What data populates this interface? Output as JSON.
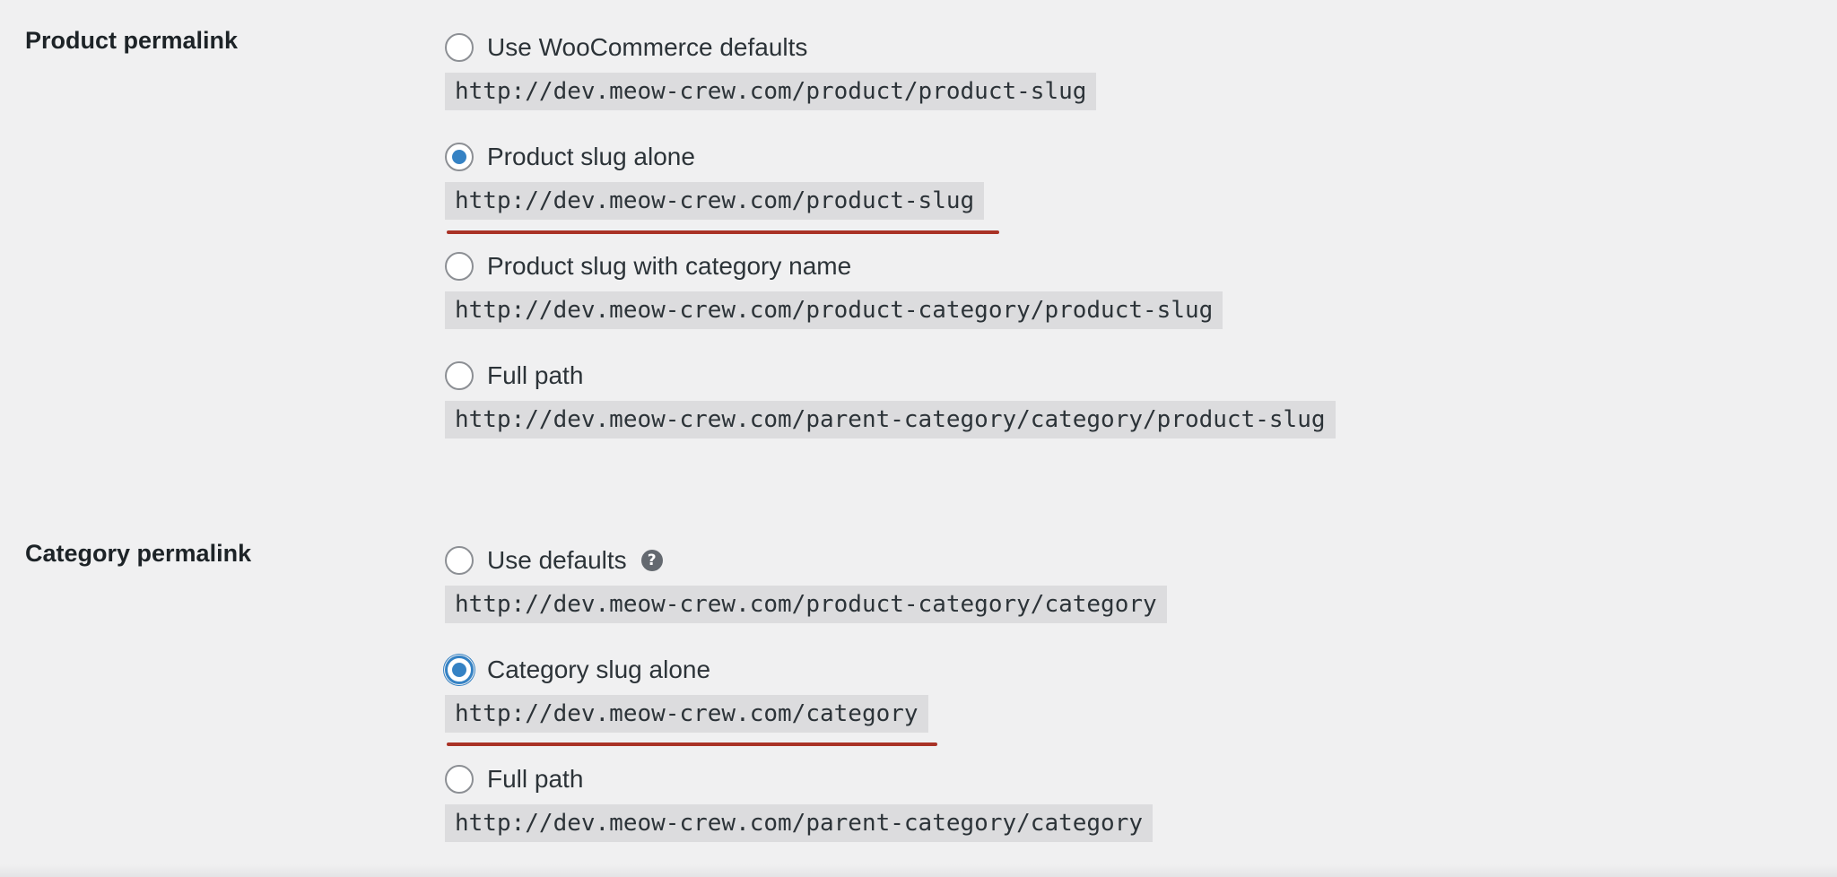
{
  "product_permalink": {
    "title": "Product permalink",
    "options": [
      {
        "label": "Use WooCommerce defaults",
        "url": "http://dev.meow-crew.com/product/product-slug",
        "checked": false
      },
      {
        "label": "Product slug alone",
        "url": "http://dev.meow-crew.com/product-slug",
        "checked": true
      },
      {
        "label": "Product slug with category name",
        "url": "http://dev.meow-crew.com/product-category/product-slug",
        "checked": false
      },
      {
        "label": "Full path",
        "url": "http://dev.meow-crew.com/parent-category/category/product-slug",
        "checked": false
      }
    ]
  },
  "category_permalink": {
    "title": "Category permalink",
    "help_icon": "question-mark-icon",
    "help_glyph": "?",
    "options": [
      {
        "label": "Use defaults",
        "url": "http://dev.meow-crew.com/product-category/category",
        "checked": false
      },
      {
        "label": "Category slug alone",
        "url": "http://dev.meow-crew.com/category",
        "checked": true
      },
      {
        "label": "Full path",
        "url": "http://dev.meow-crew.com/parent-category/category",
        "checked": false
      }
    ]
  },
  "colors": {
    "background": "#f0f0f1",
    "accent": "#3582c4",
    "code_background": "#dcdcde",
    "annotation_underline": "#a93226"
  }
}
